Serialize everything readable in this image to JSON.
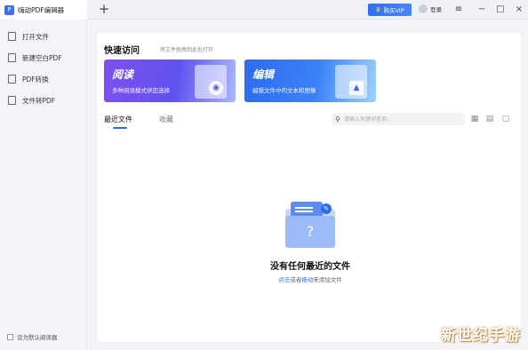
{
  "app": {
    "title": "嗨动PDF编辑器",
    "logo_icon": "pdf-logo-icon"
  },
  "topbar": {
    "new_tab_label": "+",
    "vip_label": "购买VIP",
    "login_label": "登录",
    "menu_icon": "≡",
    "minimize_icon": "−",
    "maximize_icon": "□",
    "close_icon": "×"
  },
  "sidebar": {
    "items": [
      {
        "label": "打开文件",
        "icon": "open-file-icon"
      },
      {
        "label": "新建空白PDF",
        "icon": "new-pdf-icon"
      },
      {
        "label": "PDF转换",
        "icon": "convert-icon"
      },
      {
        "label": "文件转PDF",
        "icon": "file-to-pdf-icon"
      }
    ],
    "default_reader_label": "设为默认阅读器"
  },
  "main": {
    "quick_title": "快速访问",
    "quick_hint": "将文件拖拽到此处打开",
    "cards": [
      {
        "title": "阅读",
        "subtitle": "多种阅读模式供您选择",
        "color": "#6a50ef"
      },
      {
        "title": "编辑",
        "subtitle": "编辑文件中的文本和图像",
        "color": "#2f6bef"
      }
    ],
    "tabs": [
      {
        "label": "最近文件",
        "active": true
      },
      {
        "label": "收藏",
        "active": false
      }
    ],
    "search": {
      "placeholder": "请输入关键词查询..."
    },
    "empty": {
      "title": "没有任何最近的文件",
      "hint_link1": "点击",
      "hint_mid": "或者",
      "hint_link2": "拖动",
      "hint_end": "来添加文件",
      "question_mark": "?"
    }
  },
  "watermark": "新世纪手游",
  "colors": {
    "accent": "#2f6bef",
    "read_card": "#6a50ef"
  }
}
